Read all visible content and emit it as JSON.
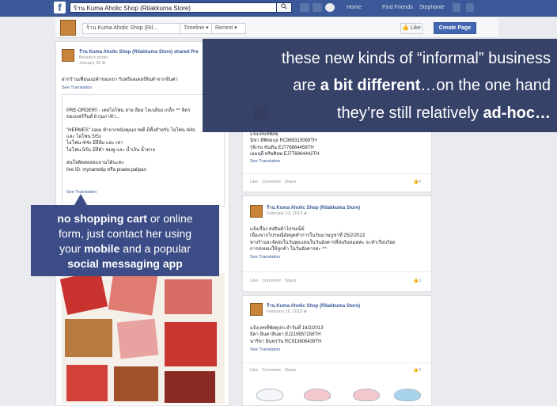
{
  "topbar": {
    "logo": "f",
    "search_value": "ร้าน Kuma Aholic Shop (Rilakkuma Store)",
    "search_icon": "search-icon",
    "links": [
      "Home",
      "Find Friends",
      "Stephanie"
    ]
  },
  "page_header": {
    "crumb_page": "ร้าน Kuma Aholic Shop (Ril...",
    "crumb_timeline": "Timeline ▾",
    "crumb_recent": "Recent ▾",
    "like_label": "👍 Like",
    "create_page_label": "Create Page"
  },
  "left_post": {
    "title": "ร้าน Kuma Aholic Shop (Rilakkuma Store) shared Pre",
    "subtitle": "Beauty's photo.",
    "date": "January 25 ⊕",
    "intro": "ฝากร้านเพื่อนแม่ค้าของเขา รับพรีออเดอร์สินค้าจากจีนค่า",
    "see_translation": "See Translation",
    "body": "PRE-ORDER!! - เคสไอโฟน ลาย ลีออ โลเบลีอง เกล็ก ^^ ลิตร\nของแฟร์รีนท์ 8 กุมภาพ้า...\n\n\"HERMES\" case ทำจากหนังคุณภาพดี มีทั้งสำหรับ ไอโฟน 4/4s\nและ ไอโฟน 5/5s\nไอโฟน 4/4s มีสีส้ม และ เทา\nไอโฟน 5/5s มีสีดำ ชมพู และ น้ำเงิน น้ำตาล\n\nสนใจติดต่อสอบถามได้นะคะ\nline ID: mynametip หรือ praew.palipan",
    "see_translation2": "See Translation"
  },
  "right_posts": [
    {
      "title": "",
      "date": "",
      "body": "แจ้งเลขที่พัสดุ\nนิชา ดีพิทยกุล RC969315069TH\nรุจิเรข ขันติน EJ776864456TH\nเอมฤดี พริยศิลพ EJ776864442TH",
      "see_translation": "See Translation",
      "actions": "Like · Comment · Share",
      "count": "👍4"
    },
    {
      "title": "ร้าน Kuma Aholic Shop (Rilakkuma Store)",
      "date": "February 22, 2013 ⊕",
      "body": "แจ้งเรื่อง ส่งสินค้าไปรษณีย์\nเนื่องจากไปรษณีย์หยุดทำการในวันมาฆบูชาที่ 25/2/2013\nทางร้านจะจัดส่งในวันพุธแทนในวันอังคารที่ส่งกันหมดค่ะ จะทำเรียบร้อย\nการส่งของให้ลูกค้า ในวันอังคารค่ะ ^^",
      "see_translation": "See Translation",
      "actions": "Like · Comment · Share",
      "count": "👍3"
    },
    {
      "title": "ร้าน Kuma Aholic Shop (Rilakkuma Store)",
      "date": "February 16, 2013 ⊕",
      "body": "แจ้งเลขที่พัสดุประจำวันที่ 16/2/2013\nธิดา อินคาลินดา EJ219957258TH\nนาริชา อินทรวัน RC913606439TH",
      "see_translation": "See Translation",
      "actions": "Like · Comment · Share",
      "count": "👍3"
    }
  ],
  "overlay_top": {
    "line1": "these new kinds of “informal” business",
    "line2_a": "are ",
    "line2_b": "a bit different",
    "line2_c": "…on the one hand",
    "line3_a": "they’re still relatively ",
    "line3_b": "ad-hoc…"
  },
  "overlay_bottom": {
    "l1_a": "no shopping cart",
    "l1_b": " or online",
    "l2": "form, just contact her using",
    "l3_a": "your ",
    "l3_b": "mobile",
    "l3_c": " and a popular",
    "l4": "social messaging app"
  },
  "colors": {
    "facebook_blue": "#3b5998",
    "overlay_dark": "#2f3a63",
    "overlay_mid": "#3c4c86",
    "link_blue": "#385898"
  }
}
